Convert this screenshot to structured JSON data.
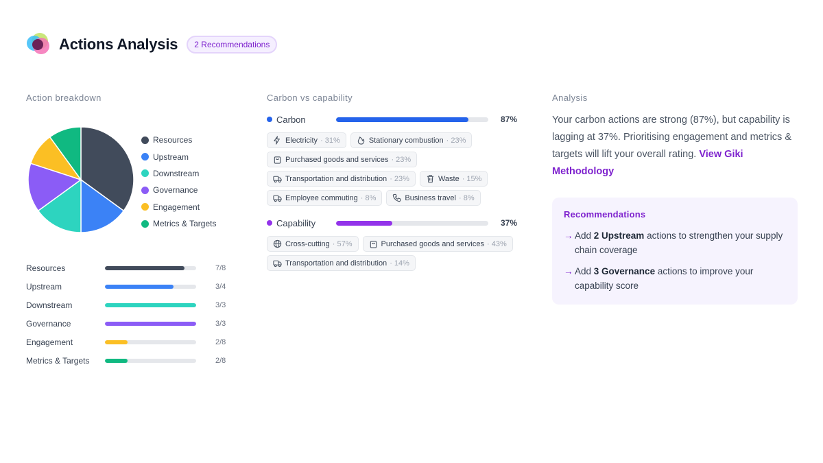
{
  "header": {
    "title": "Actions Analysis",
    "badge": "2 Recommendations"
  },
  "breakdown": {
    "section_title": "Action breakdown",
    "items": [
      {
        "label": "Resources",
        "count": "7/8",
        "value": 7,
        "max": 8,
        "color": "#414b5b"
      },
      {
        "label": "Upstream",
        "count": "3/4",
        "value": 3,
        "max": 4,
        "color": "#3b82f6"
      },
      {
        "label": "Downstream",
        "count": "3/3",
        "value": 3,
        "max": 3,
        "color": "#2dd4bf"
      },
      {
        "label": "Governance",
        "count": "3/3",
        "value": 3,
        "max": 3,
        "color": "#8b5cf6"
      },
      {
        "label": "Engagement",
        "count": "2/8",
        "value": 2,
        "max": 8,
        "color": "#fbbf24"
      },
      {
        "label": "Metrics & Targets",
        "count": "2/8",
        "value": 2,
        "max": 8,
        "color": "#10b981"
      }
    ]
  },
  "carbon_capability": {
    "section_title": "Carbon vs capability",
    "carbon": {
      "label": "Carbon",
      "percent_text": "87%",
      "fraction": 0.87,
      "color": "#2563eb",
      "chips": [
        {
          "label": "Electricity",
          "pct": "· 31%",
          "icon": "lightning-icon"
        },
        {
          "label": "Stationary combustion",
          "pct": "· 23%",
          "icon": "flame-icon"
        },
        {
          "label": "Purchased goods and services",
          "pct": "· 23%",
          "icon": "shopping-bag-icon"
        },
        {
          "label": "Transportation and distribution",
          "pct": "· 23%",
          "icon": "truck-icon"
        },
        {
          "label": "Waste",
          "pct": "· 15%",
          "icon": "trash-icon"
        },
        {
          "label": "Employee commuting",
          "pct": "· 8%",
          "icon": "truck-icon"
        },
        {
          "label": "Business travel",
          "pct": "· 8%",
          "icon": "phone-icon"
        }
      ]
    },
    "capability": {
      "label": "Capability",
      "percent_text": "37%",
      "fraction": 0.37,
      "color": "#9333ea",
      "chips": [
        {
          "label": "Cross-cutting",
          "pct": "· 57%",
          "icon": "globe-icon"
        },
        {
          "label": "Purchased goods and services",
          "pct": "· 43%",
          "icon": "shopping-bag-icon"
        },
        {
          "label": "Transportation and distribution",
          "pct": "· 14%",
          "icon": "truck-icon"
        }
      ]
    }
  },
  "analysis": {
    "section_title": "Analysis",
    "text": "Your carbon actions are strong (87%), but capability is lagging at 37%. Prioritising engagement and metrics & targets will lift your overall rating.",
    "link": "View Giki Methodology"
  },
  "recommendations": {
    "title": "Recommendations",
    "items": [
      {
        "arrow": "→",
        "pre": "Add ",
        "bold": "2 Upstream",
        "post": " actions to strengthen your supply chain coverage"
      },
      {
        "arrow": "→",
        "pre": "Add ",
        "bold": "3 Governance",
        "post": " actions to improve your capability score"
      }
    ]
  }
}
